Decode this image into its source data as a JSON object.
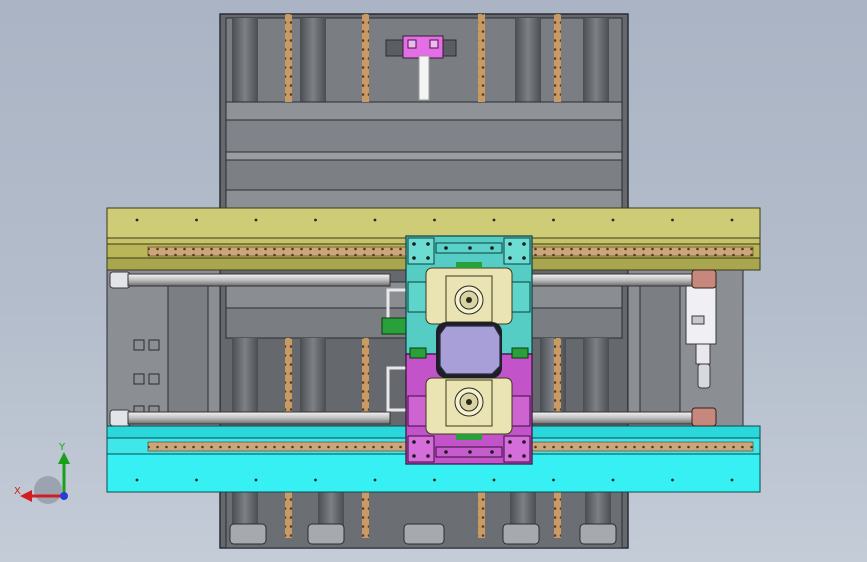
{
  "viewport": {
    "background_top": "#aab4c4",
    "background_bottom": "#c4ccd8"
  },
  "triad": {
    "x_label": "X",
    "y_label": "Y",
    "x_color": "#d21e1e",
    "y_color": "#19a019",
    "z_color": "#2a3bd6"
  },
  "model": {
    "colors": {
      "frame": "#6f7378",
      "frame_light": "#9ea2a6",
      "rail_olive": "#c6c36a",
      "rail_cyan": "#33eef2",
      "rail_strip": "#caa77a",
      "carriage_teal": "#55cdc4",
      "carriage_purple": "#c253c8",
      "plate_cream": "#eae4b4",
      "center_block": "#a99fd8",
      "accent_pink": "#e46ee6",
      "rod": "#d8d8d8",
      "bracket": "#c6887c"
    }
  }
}
